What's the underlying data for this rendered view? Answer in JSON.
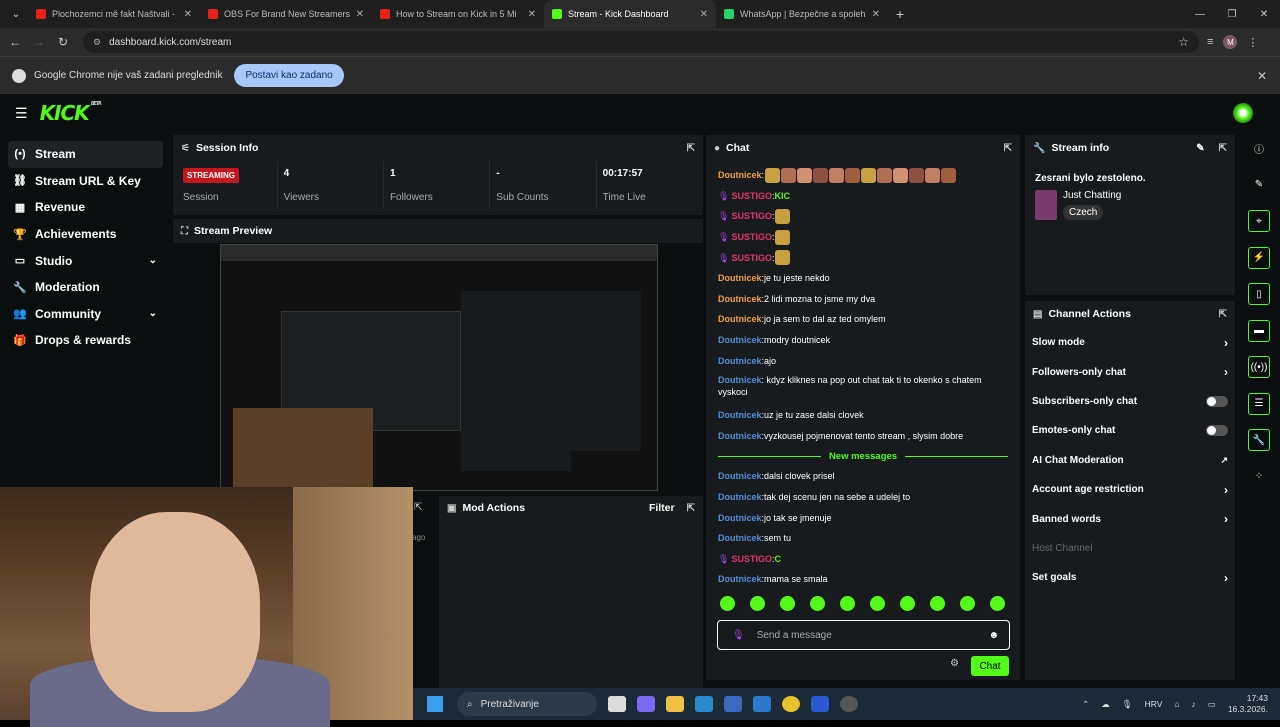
{
  "browser": {
    "tabs": [
      {
        "title": "Plochozemci mě fakt Naštvali -",
        "color": "#e62117",
        "active": false
      },
      {
        "title": "OBS For Brand New Streamers",
        "color": "#e62117",
        "active": false
      },
      {
        "title": "How to Stream on Kick in 5 Mi",
        "color": "#e62117",
        "active": false
      },
      {
        "title": "Stream - Kick Dashboard",
        "color": "#53fc18",
        "active": true
      },
      {
        "title": "WhatsApp | Bezpečne a spoleh",
        "color": "#25d366",
        "active": false
      }
    ],
    "url": "dashboard.kick.com/stream",
    "profile_initial": "M",
    "infobar_text": "Google Chrome nije vaš zadani preglednik",
    "infobar_button": "Postavi kao zadano"
  },
  "app": {
    "logo": "KICK",
    "beta": "BETA",
    "accent": "#53fc18",
    "nav": [
      {
        "label": "Stream",
        "icon": "(•)",
        "active": true,
        "chevron": false
      },
      {
        "label": "Stream URL & Key",
        "icon": "⛓",
        "active": false,
        "chevron": false
      },
      {
        "label": "Revenue",
        "icon": "▦",
        "active": false,
        "chevron": false
      },
      {
        "label": "Achievements",
        "icon": "🏆",
        "active": false,
        "chevron": false
      },
      {
        "label": "Studio",
        "icon": "▭",
        "active": false,
        "chevron": true
      },
      {
        "label": "Moderation",
        "icon": "🔧",
        "active": false,
        "chevron": false
      },
      {
        "label": "Community",
        "icon": "👥",
        "active": false,
        "chevron": true
      },
      {
        "label": "Drops & rewards",
        "icon": "🎁",
        "active": false,
        "chevron": false
      }
    ]
  },
  "session": {
    "title": "Session Info",
    "status": "STREAMING",
    "status_label": "Session",
    "stats": [
      {
        "value": "4",
        "label": "Viewers"
      },
      {
        "value": "1",
        "label": "Followers"
      },
      {
        "value": "-",
        "label": "Sub Counts"
      },
      {
        "value": "00:17:57",
        "label": "Time Live"
      }
    ]
  },
  "preview": {
    "title": "Stream Preview"
  },
  "mod": {
    "title": "Mod Actions",
    "filter": "Filter",
    "ago": "ago"
  },
  "chat": {
    "title": "Chat",
    "messages": [
      {
        "user": "Doutnicek",
        "cls": "o",
        "text": "",
        "emotes": 12,
        "mic": false
      },
      {
        "user": "SUSTIGO",
        "cls": "p",
        "text": "KIC",
        "emotes": 0,
        "mic": true
      },
      {
        "user": "SUSTIGO",
        "cls": "p",
        "text": "",
        "emotes": 1,
        "mic": true
      },
      {
        "user": "SUSTIGO",
        "cls": "p",
        "text": "",
        "emotes": 1,
        "mic": true
      },
      {
        "user": "SUSTIGO",
        "cls": "p",
        "text": "",
        "emotes": 1,
        "mic": true
      },
      {
        "user": "Doutnicek",
        "cls": "o",
        "text": "je tu jeste nekdo"
      },
      {
        "user": "Doutnicek",
        "cls": "o",
        "text": "2 lidi mozna to jsme my dva"
      },
      {
        "user": "Doutnicek",
        "cls": "o",
        "text": "jo ja sem to dal az ted omylem"
      },
      {
        "user": "Doutnicek",
        "cls": "b",
        "text": "modry doutnicek"
      },
      {
        "user": "Doutnicek",
        "cls": "b",
        "text": "ajo"
      },
      {
        "user": "Doutnicek",
        "cls": "b",
        "text": "kdyz kliknes na pop out chat tak ti to okenko s chatem vyskoci",
        "wrap": true
      },
      {
        "user": "Doutnicek",
        "cls": "b",
        "text": "uz je tu zase dalsi clovek"
      },
      {
        "user": "Doutnicek",
        "cls": "b",
        "text": "vyzkousej pojmenovat tento stream , slysim dobre"
      }
    ],
    "new_messages_label": "New messages",
    "messages_after": [
      {
        "user": "Doutnicek",
        "cls": "b",
        "text": "dalsi clovek prisel"
      },
      {
        "user": "Doutnicek",
        "cls": "b",
        "text": "tak dej scenu jen na sebe a udelej to"
      },
      {
        "user": "Doutnicek",
        "cls": "b",
        "text": "jo tak se jmenuje"
      },
      {
        "user": "Doutnicek",
        "cls": "b",
        "text": "sem tu"
      },
      {
        "user": "SUSTIGO",
        "cls": "p",
        "text": "C",
        "mic": true
      },
      {
        "user": "Doutnicek",
        "cls": "b",
        "text": "mama se smala"
      }
    ],
    "input_placeholder": "Send a message",
    "send_button": "Chat"
  },
  "stream_info": {
    "title": "Stream info",
    "stream_title": "Zesrani bylo zestoleno.",
    "category": "Just Chatting",
    "language": "Czech"
  },
  "channel_actions": {
    "title": "Channel Actions",
    "items": [
      {
        "label": "Slow mode",
        "kind": "arrow"
      },
      {
        "label": "Followers-only chat",
        "kind": "arrow"
      },
      {
        "label": "Subscribers-only chat",
        "kind": "toggle",
        "on": false
      },
      {
        "label": "Emotes-only chat",
        "kind": "toggle",
        "on": false
      },
      {
        "label": "AI Chat Moderation",
        "kind": "external"
      },
      {
        "label": "Account age restriction",
        "kind": "arrow"
      },
      {
        "label": "Banned words",
        "kind": "arrow"
      },
      {
        "label": "Host Channel",
        "kind": "disabled"
      },
      {
        "label": "Set goals",
        "kind": "arrow"
      }
    ]
  },
  "taskbar": {
    "search": "Pretraživanje",
    "lang": "HRV",
    "time": "17:43",
    "date": "16.3.2026."
  }
}
